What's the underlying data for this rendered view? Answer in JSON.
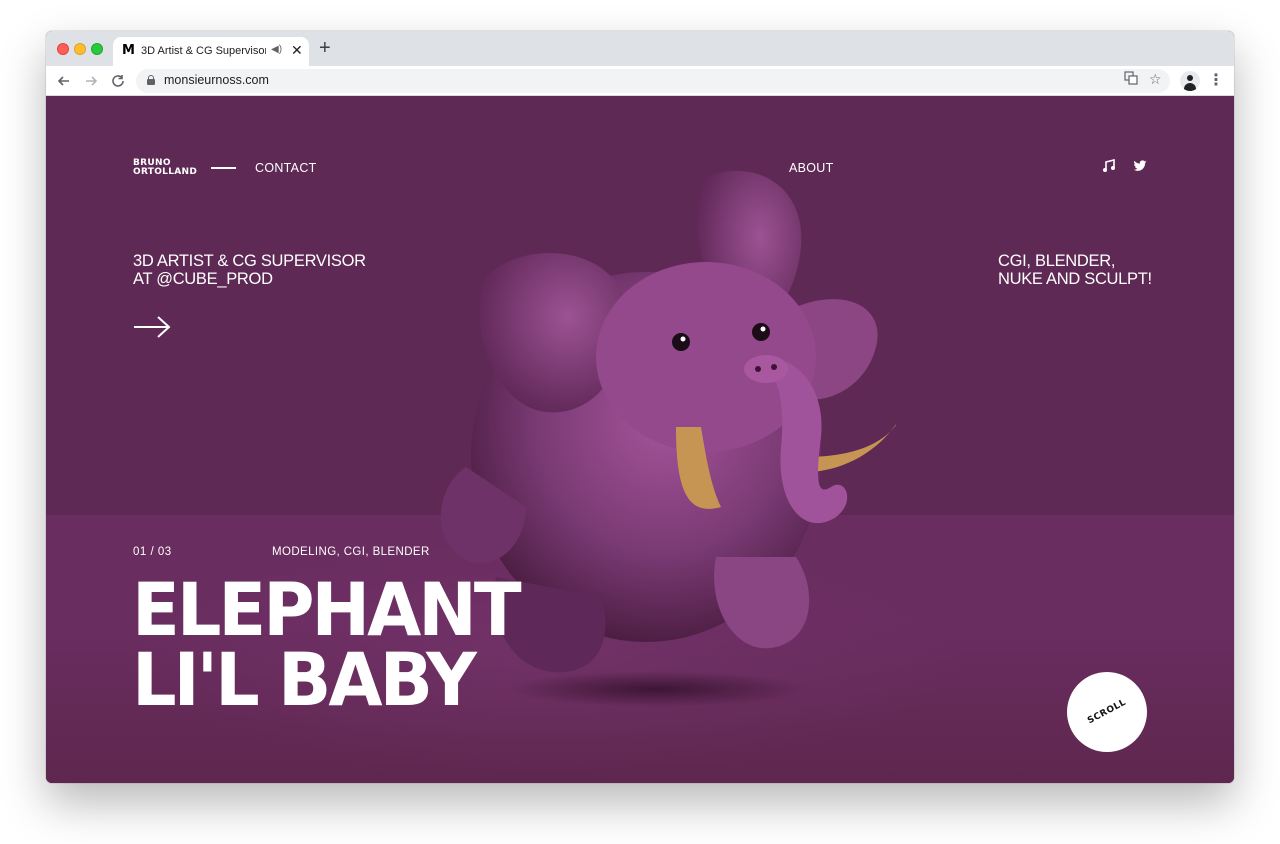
{
  "browser": {
    "tab_title": "3D Artist & CG Supervisor -",
    "tab_favicon": "M",
    "url": "monsieurnoss.com"
  },
  "site": {
    "logo_line1": "BRUNO",
    "logo_line2": "ORTOLLAND",
    "nav_contact": "CONTACT",
    "nav_about": "ABOUT",
    "tagline_left_line1": "3D ARTIST & CG SUPERVISOR",
    "tagline_left_line2": "AT @CUBE_PROD",
    "tagline_right_line1": "CGI, BLENDER,",
    "tagline_right_line2": "NUKE AND SCULPT!",
    "counter": "01 / 03",
    "tags": "MODELING, CGI, BLENDER",
    "title_line1": "ELEPHANT",
    "title_line2": "LI'L BABY",
    "scroll_label": "SCROLL",
    "bg_color": "#5f2955",
    "icons": [
      "music-icon",
      "twitter-icon",
      "arrow-right-icon"
    ]
  }
}
